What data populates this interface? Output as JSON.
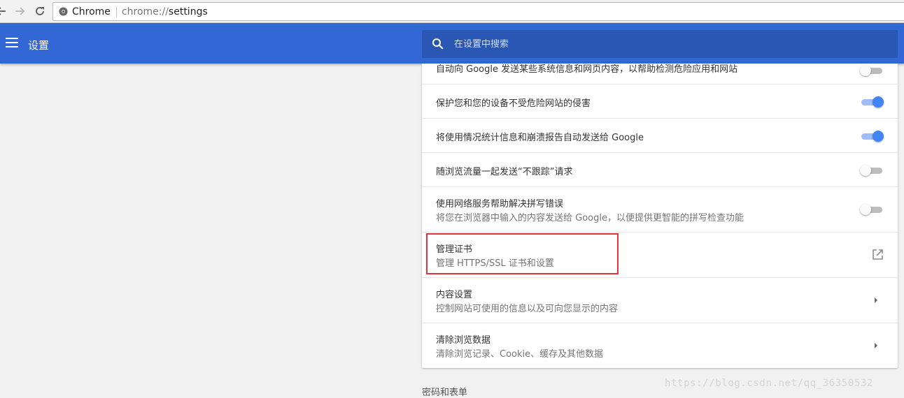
{
  "browser": {
    "chip_label": "Chrome",
    "url_scheme": "chrome://",
    "url_host": "settings"
  },
  "header": {
    "title": "设置",
    "search_placeholder": "在设置中搜索",
    "accent_color": "#3367d6"
  },
  "rows": [
    {
      "title": "自动向 Google 发送某些系统信息和网页内容，以帮助检测危险应用和网站",
      "control": "toggle",
      "state": "off"
    },
    {
      "title": "保护您和您的设备不受危险网站的侵害",
      "control": "toggle",
      "state": "on"
    },
    {
      "title": "将使用情况统计信息和崩溃报告自动发送给 Google",
      "control": "toggle",
      "state": "on"
    },
    {
      "title": "随浏览流量一起发送“不跟踪”请求",
      "control": "toggle",
      "state": "off"
    },
    {
      "title": "使用网络服务帮助解决拼写错误",
      "subtitle": "将您在浏览器中输入的内容发送给 Google，以便提供更智能的拼写检查功能",
      "control": "toggle",
      "state": "off"
    },
    {
      "title": "管理证书",
      "subtitle": "管理 HTTPS/SSL 证书和设置",
      "control": "external-link-icon"
    },
    {
      "title": "内容设置",
      "subtitle": "控制网站可使用的信息以及可向您显示的内容",
      "control": "chevron-right-icon"
    },
    {
      "title": "清除浏览数据",
      "subtitle": "清除浏览记录、Cookie、缓存及其他数据",
      "control": "chevron-right-icon"
    }
  ],
  "next_section_title": "密码和表单",
  "watermark": "https://blog.csdn.net/qq_36350532",
  "highlight_color": "#e0343b"
}
